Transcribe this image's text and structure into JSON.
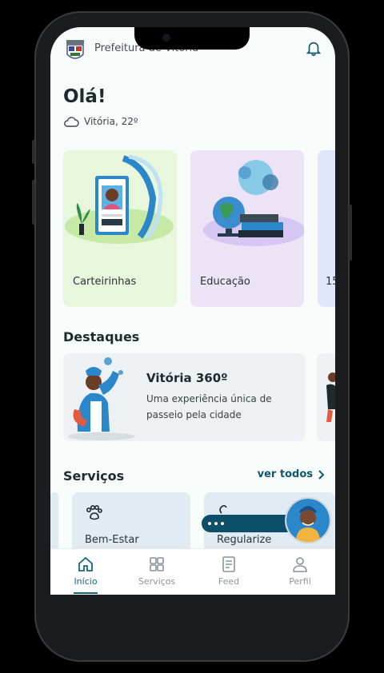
{
  "header": {
    "city_title": "Prefeitura de Vitória"
  },
  "greeting": {
    "title": "Olá!",
    "weather": "Vitória, 22º"
  },
  "quick_cards": [
    {
      "label": "Carteirinhas",
      "color": "#e8f6dc"
    },
    {
      "label": "Educação",
      "color": "#ece4f6"
    },
    {
      "label": "15",
      "color": "#dfe7fb"
    }
  ],
  "highlights": {
    "title": "Destaques",
    "items": [
      {
        "title": "Vitória 360º",
        "description": "Uma experiência única de passeio pela cidade"
      }
    ]
  },
  "services": {
    "title": "Serviços",
    "see_all": "ver todos",
    "items": [
      {
        "label": "Bem-Estar",
        "icon": "paw-icon"
      },
      {
        "label": "Regularize",
        "icon": "document-icon"
      }
    ]
  },
  "tabbar": {
    "items": [
      {
        "label": "Início",
        "icon": "home-icon",
        "active": true
      },
      {
        "label": "Serviços",
        "icon": "grid-icon",
        "active": false
      },
      {
        "label": "Feed",
        "icon": "feed-icon",
        "active": false
      },
      {
        "label": "Perfil",
        "icon": "user-icon",
        "active": false
      }
    ]
  },
  "colors": {
    "accent": "#0f5670",
    "active_tab": "#17667f"
  }
}
